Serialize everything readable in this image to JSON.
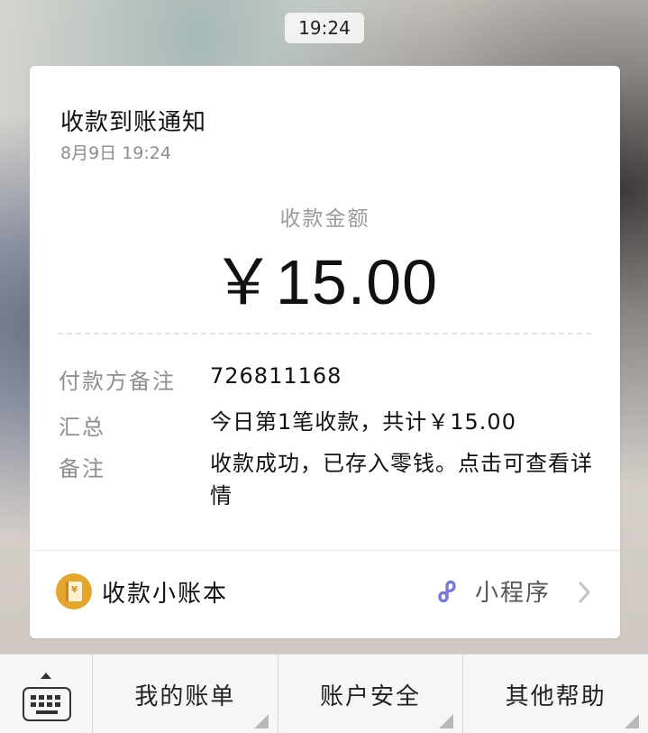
{
  "status_time": "19:24",
  "card": {
    "title": "收款到账通知",
    "date": "8月9日  19:24",
    "amount_label": "收款金额",
    "amount": "￥15.00",
    "details": [
      {
        "key": "付款方备注",
        "value": "726811168"
      },
      {
        "key": "汇总",
        "value": "今日第1笔收款，共计￥15.00"
      },
      {
        "key": "备注",
        "value": "收款成功，已存入零钱。点击可查看详情"
      }
    ],
    "footer": {
      "app_name": "收款小账本",
      "book_icon": "ledger-book-icon",
      "book_glyph": "¥",
      "mini_program_label": "小程序",
      "mini_program_icon": "mini-program-icon",
      "accent_color": "#e3a72f",
      "mini_program_color": "#7a79d6"
    }
  },
  "menu": {
    "keyboard_icon": "keyboard-icon",
    "items": [
      "我的账单",
      "账户安全",
      "其他帮助"
    ]
  }
}
